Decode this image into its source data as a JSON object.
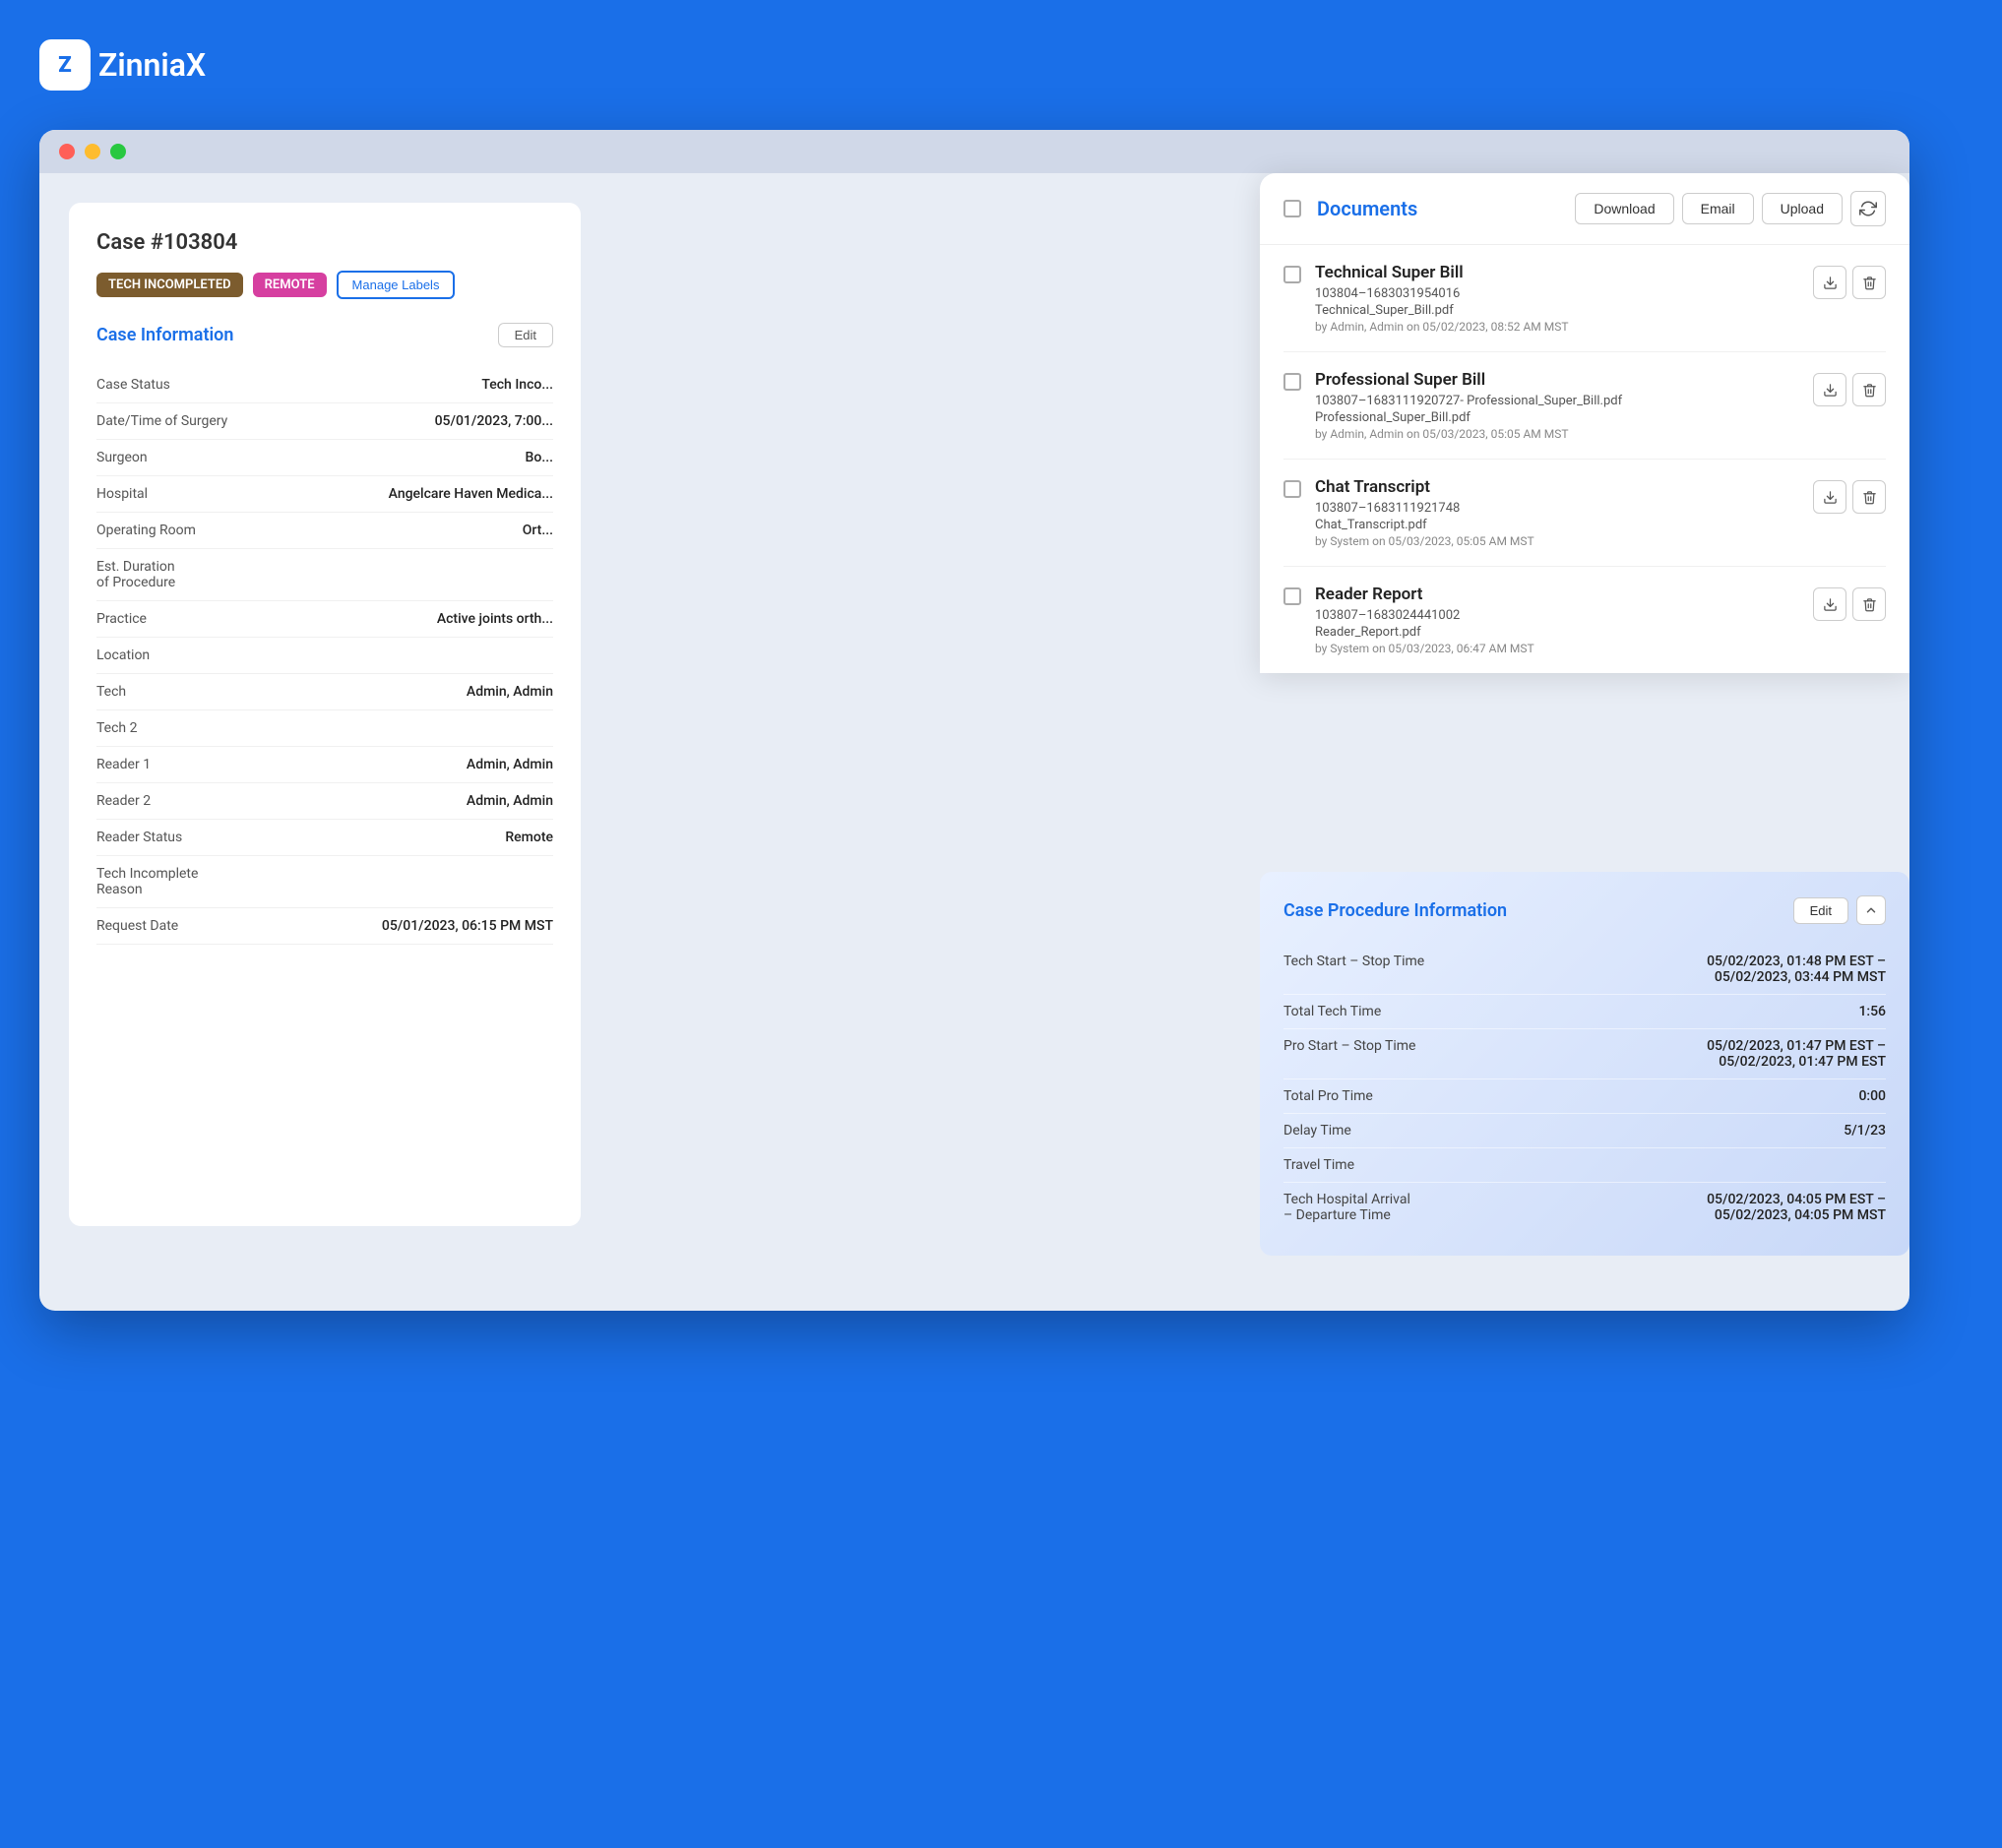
{
  "logo": {
    "icon_text": "Z",
    "name": "ZinniaX"
  },
  "case_panel": {
    "case_number": "Case #103804",
    "labels": [
      {
        "text": "TECH INCOMPLETED",
        "class": "label-tech"
      },
      {
        "text": "REMOTE",
        "class": "label-remote"
      }
    ],
    "manage_labels_btn": "Manage Labels",
    "section_title": "Case Information",
    "edit_btn": "Edit",
    "fields": [
      {
        "label": "Case Status",
        "value": "Tech Inco..."
      },
      {
        "label": "Date/Time of Surgery",
        "value": "05/01/2023, 7:00..."
      },
      {
        "label": "Surgeon",
        "value": "Bo..."
      },
      {
        "label": "Hospital",
        "value": "Angelcare Haven Medica..."
      },
      {
        "label": "Operating Room",
        "value": "Ort..."
      },
      {
        "label": "Est. Duration\nof Procedure",
        "value": ""
      },
      {
        "label": "Practice",
        "value": "Active joints orth..."
      },
      {
        "label": "Location",
        "value": ""
      },
      {
        "label": "Tech",
        "value": "Admin, Admin"
      },
      {
        "label": "Tech 2",
        "value": ""
      },
      {
        "label": "Reader 1",
        "value": "Admin, Admin"
      },
      {
        "label": "Reader 2",
        "value": "Admin, Admin"
      },
      {
        "label": "Reader Status",
        "value": "Remote"
      },
      {
        "label": "Tech Incomplete\nReason",
        "value": ""
      },
      {
        "label": "Request Date",
        "value": "05/01/2023, 06:15 PM MST"
      }
    ]
  },
  "documents_panel": {
    "title": "Documents",
    "download_btn": "Download",
    "email_btn": "Email",
    "upload_btn": "Upload",
    "documents": [
      {
        "name": "Technical Super Bill",
        "id": "103804–1683031954016",
        "filename": "Technical_Super_Bill.pdf",
        "meta": "by Admin, Admin on 05/02/2023, 08:52 AM MST"
      },
      {
        "name": "Professional Super Bill",
        "id": "103807–1683111920727-\nProfessional_Super_Bill.pdf",
        "filename": "Professional_Super_Bill.pdf",
        "meta": "by Admin, Admin on 05/03/2023, 05:05 AM MST"
      },
      {
        "name": "Chat Transcript",
        "id": "103807–1683111921748",
        "filename": "Chat_Transcript.pdf",
        "meta": "by System on 05/03/2023, 05:05 AM MST"
      },
      {
        "name": "Reader Report",
        "id": "103807–1683024441002",
        "filename": "Reader_Report.pdf",
        "meta": "by System on 05/03/2023, 06:47 AM MST"
      }
    ]
  },
  "procedure_panel": {
    "title": "Case Procedure Information",
    "edit_btn": "Edit",
    "fields": [
      {
        "label": "Tech Start – Stop Time",
        "value": "05/02/2023, 01:48 PM EST –\n05/02/2023, 03:44 PM MST"
      },
      {
        "label": "Total Tech Time",
        "value": "1:56"
      },
      {
        "label": "Pro Start – Stop Time",
        "value": "05/02/2023, 01:47 PM EST –\n05/02/2023, 01:47 PM EST"
      },
      {
        "label": "Total Pro Time",
        "value": "0:00"
      },
      {
        "label": "Delay Time",
        "value": "5/1/23"
      },
      {
        "label": "Travel Time",
        "value": ""
      },
      {
        "label": "Tech Hospital Arrival\n– Departure Time",
        "value": "05/02/2023, 04:05 PM EST –\n05/02/2023, 04:05 PM MST"
      }
    ]
  }
}
